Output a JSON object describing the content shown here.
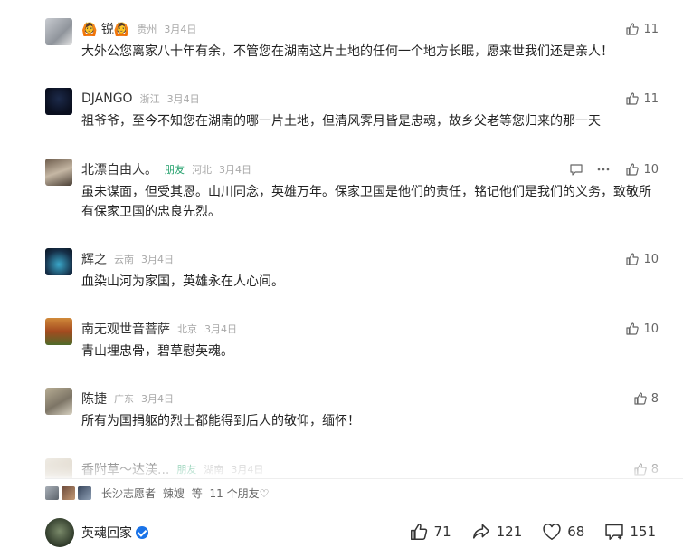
{
  "comments": [
    {
      "name": "🙆 锐🙆",
      "badge": "",
      "location": "贵州",
      "date": "3月4日",
      "text": "大外公您离家八十年有余，不管您在湖南这片土地的任何一个地方长眠，愿来世我们还是亲人！",
      "likes": "11"
    },
    {
      "name": "DJANGO",
      "badge": "",
      "location": "浙江",
      "date": "3月4日",
      "text": "祖爷爷，至今不知您在湖南的哪一片土地，但清风霁月皆是忠魂，故乡父老等您归来的那一天",
      "likes": "11"
    },
    {
      "name": "北漂自由人。",
      "badge": "朋友",
      "location": "河北",
      "date": "3月4日",
      "text": "虽未谋面，但受其恩。山川同念，英雄万年。保家卫国是他们的责任，铭记他们是我们的义务，致敬所有保家卫国的忠良先烈。",
      "likes": "10"
    },
    {
      "name": "辉之",
      "badge": "",
      "location": "云南",
      "date": "3月4日",
      "text": "血染山河为家国，英雄永在人心间。",
      "likes": "10"
    },
    {
      "name": "南无观世音菩萨",
      "badge": "",
      "location": "北京",
      "date": "3月4日",
      "text": "青山埋忠骨，碧草慰英魂。",
      "likes": "10"
    },
    {
      "name": "陈捷",
      "badge": "",
      "location": "广东",
      "date": "3月4日",
      "text": "所有为国捐躯的烈士都能得到后人的敬仰，缅怀！",
      "likes": "8"
    },
    {
      "name": "香附草～达渼...",
      "badge": "朋友",
      "location": "湖南",
      "date": "3月4日",
      "text": "",
      "likes": "8"
    }
  ],
  "friends_bar": {
    "name1": "长沙志愿者",
    "name2": "辣嫂",
    "name3": "等",
    "tail": "11 个朋友♡"
  },
  "author": {
    "name": "英魂回家"
  },
  "actions": {
    "likes": "71",
    "shares": "121",
    "favorites": "68",
    "comments": "151"
  },
  "colors": {
    "friend_badge": "#22a06b",
    "verified": "#1a73e8",
    "meta_gray": "#a8a8a8"
  },
  "icons": [
    "thumb-up-icon",
    "comment-icon",
    "more-icon",
    "share-icon",
    "heart-icon",
    "verified-icon"
  ]
}
